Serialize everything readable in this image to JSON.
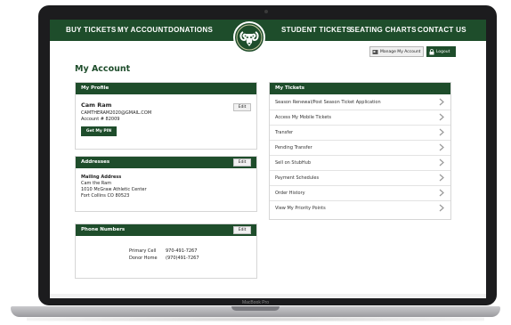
{
  "device": {
    "model_label": "MacBook Pro"
  },
  "nav": {
    "left_items": [
      "BUY TICKETS",
      "MY ACCOUNT",
      "DONATIONS"
    ],
    "right_items": [
      "STUDENT TICKETS",
      "SEATING CHARTS",
      "CONTACT US"
    ],
    "logo_icon": "ram-logo-icon"
  },
  "header_buttons": {
    "manage_label": "Manage My Account",
    "logout_label": "Logout"
  },
  "page": {
    "title": "My Account"
  },
  "profile": {
    "heading": "My Profile",
    "edit_label": "Edit",
    "name": "Cam Ram",
    "email": "CAMTHERAM2020@GMAIL.COM",
    "account": "Account # 82009",
    "pin_label": "Get My PIN"
  },
  "addresses": {
    "heading": "Addresses",
    "edit_label": "Edit",
    "type": "Mailing Address",
    "lines": [
      "Cam the Ram",
      "1010 McGraw Athletic Center",
      "Fort Collins CO 80523"
    ]
  },
  "phones": {
    "heading": "Phone Numbers",
    "edit_label": "Edit",
    "entries": [
      {
        "label": "Primary Cell",
        "number": "970-491-7267"
      },
      {
        "label": "Donor Home",
        "number": "(970)491-7267"
      }
    ]
  },
  "tickets": {
    "heading": "My Tickets",
    "items": [
      "Season Renewal/Post Season Ticket Application",
      "Access My Mobile Tickets",
      "Transfer",
      "Pending Transfer",
      "Sell on StubHub",
      "Payment Schedules",
      "Order History",
      "View My Priority Points"
    ]
  },
  "colors": {
    "brand_green": "#1e4d2b",
    "white": "#ffffff"
  }
}
